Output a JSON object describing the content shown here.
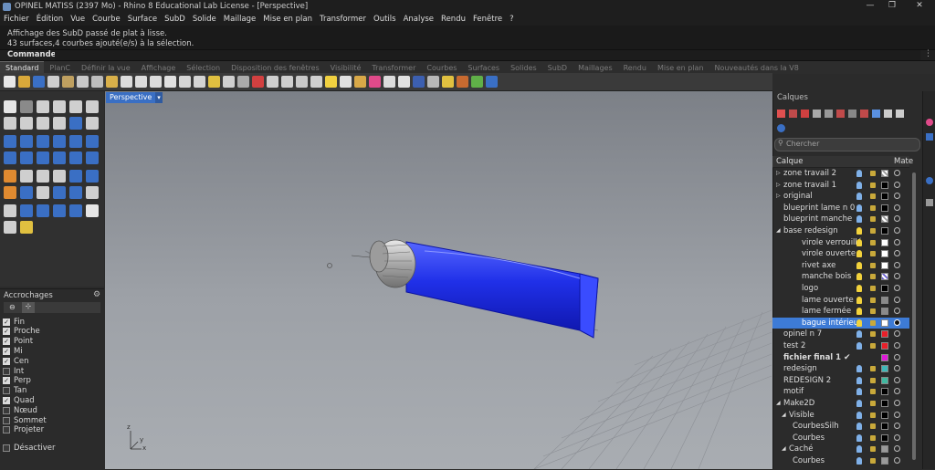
{
  "window": {
    "title": "OPINEL MATISS (2397 Mo) - Rhino 8 Educational Lab License - [Perspective]",
    "controls": [
      "—",
      "❐",
      "✕"
    ]
  },
  "menu": [
    "Fichier",
    "Édition",
    "Vue",
    "Courbe",
    "Surface",
    "SubD",
    "Solide",
    "Maillage",
    "Mise en plan",
    "Transformer",
    "Outils",
    "Analyse",
    "Rendu",
    "Fenêtre",
    "?"
  ],
  "history": [
    "Affichage des SubD passé de plat à lisse.",
    "43 surfaces,4 courbes ajouté(e/s) à la sélection."
  ],
  "command": {
    "label": "Commande:"
  },
  "tabs": [
    "Standard",
    "PlanC",
    "Définir la vue",
    "Affichage",
    "Sélection",
    "Disposition des fenêtres",
    "Visibilité",
    "Transformer",
    "Courbes",
    "Surfaces",
    "Solides",
    "SubD",
    "Maillages",
    "Rendu",
    "Mise en plan",
    "Nouveautés dans la V8"
  ],
  "viewport": {
    "tab": "Perspective",
    "axes": {
      "x": "x",
      "y": "y",
      "z": "z"
    }
  },
  "osnap": {
    "title": "Accrochages",
    "items": [
      {
        "label": "Fin",
        "checked": true
      },
      {
        "label": "Proche",
        "checked": true
      },
      {
        "label": "Point",
        "checked": true
      },
      {
        "label": "Mi",
        "checked": true
      },
      {
        "label": "Cen",
        "checked": true
      },
      {
        "label": "Int",
        "checked": false
      },
      {
        "label": "Perp",
        "checked": true
      },
      {
        "label": "Tan",
        "checked": false
      },
      {
        "label": "Quad",
        "checked": true
      },
      {
        "label": "Nœud",
        "checked": false
      },
      {
        "label": "Sommet",
        "checked": false
      },
      {
        "label": "Projeter",
        "checked": false
      }
    ],
    "disable": "Désactiver"
  },
  "layers": {
    "title": "Calques",
    "search_placeholder": "Chercher",
    "col_layer": "Calque",
    "col_mat": "Mate",
    "rows": [
      {
        "name": "zone travail 2",
        "level": 0,
        "expand": "▷",
        "bulb": "#7fb0e8",
        "swatch": "#9a9a9a",
        "swatchPattern": true
      },
      {
        "name": "zone travail 1",
        "level": 0,
        "expand": "▷",
        "bulb": "#7fb0e8",
        "swatch": "#000000"
      },
      {
        "name": "original",
        "level": 0,
        "expand": "▷",
        "bulb": "#7fb0e8",
        "swatch": "#000000"
      },
      {
        "name": "blueprint lame n 0",
        "level": 0,
        "expand": "",
        "bulb": "#7fb0e8",
        "swatch": "#000000"
      },
      {
        "name": "blueprint manche",
        "level": 0,
        "expand": "",
        "bulb": "#7fb0e8",
        "swatch": "#9a9a9a",
        "swatchPattern": true
      },
      {
        "name": "base redesign",
        "level": 0,
        "expand": "◢",
        "bulb": "#f2d23c",
        "swatch": "#000000"
      },
      {
        "name": "virole verrouillé",
        "level": 2,
        "expand": "",
        "bulb": "#f2d23c",
        "swatch": "#ffffff"
      },
      {
        "name": "virole ouverte",
        "level": 2,
        "expand": "",
        "bulb": "#f2d23c",
        "swatch": "#ffffff"
      },
      {
        "name": "rivet axe",
        "level": 2,
        "expand": "",
        "bulb": "#f2d23c",
        "swatch": "#ffffff"
      },
      {
        "name": "manche bois",
        "level": 2,
        "expand": "",
        "bulb": "#f2d23c",
        "swatch": "#6a5fd0",
        "swatchPattern": true
      },
      {
        "name": "logo",
        "level": 2,
        "expand": "",
        "bulb": "#f2d23c",
        "swatch": "#000000"
      },
      {
        "name": "lame ouverte",
        "level": 2,
        "expand": "",
        "bulb": "#f2d23c",
        "swatch": "#8a8a8a"
      },
      {
        "name": "lame fermée",
        "level": 2,
        "expand": "",
        "bulb": "#f2d23c",
        "swatch": "#8a8a8a"
      },
      {
        "name": "bague intérieur",
        "level": 2,
        "expand": "",
        "bulb": "#f2d23c",
        "swatch": "#ffffff",
        "selected": true
      },
      {
        "name": "opinel n 7",
        "level": 0,
        "expand": "",
        "bulb": "#7fb0e8",
        "swatch": "#e8202a"
      },
      {
        "name": "test 2",
        "level": 0,
        "expand": "",
        "bulb": "#7fb0e8",
        "swatch": "#e8202a"
      },
      {
        "name": "fichier final 1",
        "level": 0,
        "expand": "",
        "bold": true,
        "current": true,
        "swatch": "#e01ad8"
      },
      {
        "name": "redesign",
        "level": 0,
        "expand": "",
        "bulb": "#7fb0e8",
        "swatch": "#40b8b8"
      },
      {
        "name": "REDESIGN 2",
        "level": 0,
        "expand": "",
        "bulb": "#7fb0e8",
        "swatch": "#40b8a0"
      },
      {
        "name": "motif",
        "level": 0,
        "expand": "",
        "bulb": "#7fb0e8",
        "swatch": "#000000"
      },
      {
        "name": "Make2D",
        "level": 0,
        "expand": "◢",
        "bulb": "#7fb0e8",
        "swatch": "#000000"
      },
      {
        "name": "Visible",
        "level": 1,
        "expand": "◢",
        "bulb": "#7fb0e8",
        "swatch": "#000000"
      },
      {
        "name": "CourbesSilh",
        "level": 3,
        "expand": "",
        "bulb": "#7fb0e8",
        "swatch": "#000000"
      },
      {
        "name": "Courbes",
        "level": 3,
        "expand": "",
        "bulb": "#7fb0e8",
        "swatch": "#000000"
      },
      {
        "name": "Caché",
        "level": 1,
        "expand": "◢",
        "bulb": "#7fb0e8",
        "swatch": "#9a9a9a"
      },
      {
        "name": "Courbes",
        "level": 3,
        "expand": "",
        "bulb": "#7fb0e8",
        "swatch": "#9a9a9a"
      }
    ]
  },
  "colors": {
    "accent": "#3d7bd6",
    "viewportTab": "#3a6fc4",
    "knife": "#1f2fe0"
  }
}
